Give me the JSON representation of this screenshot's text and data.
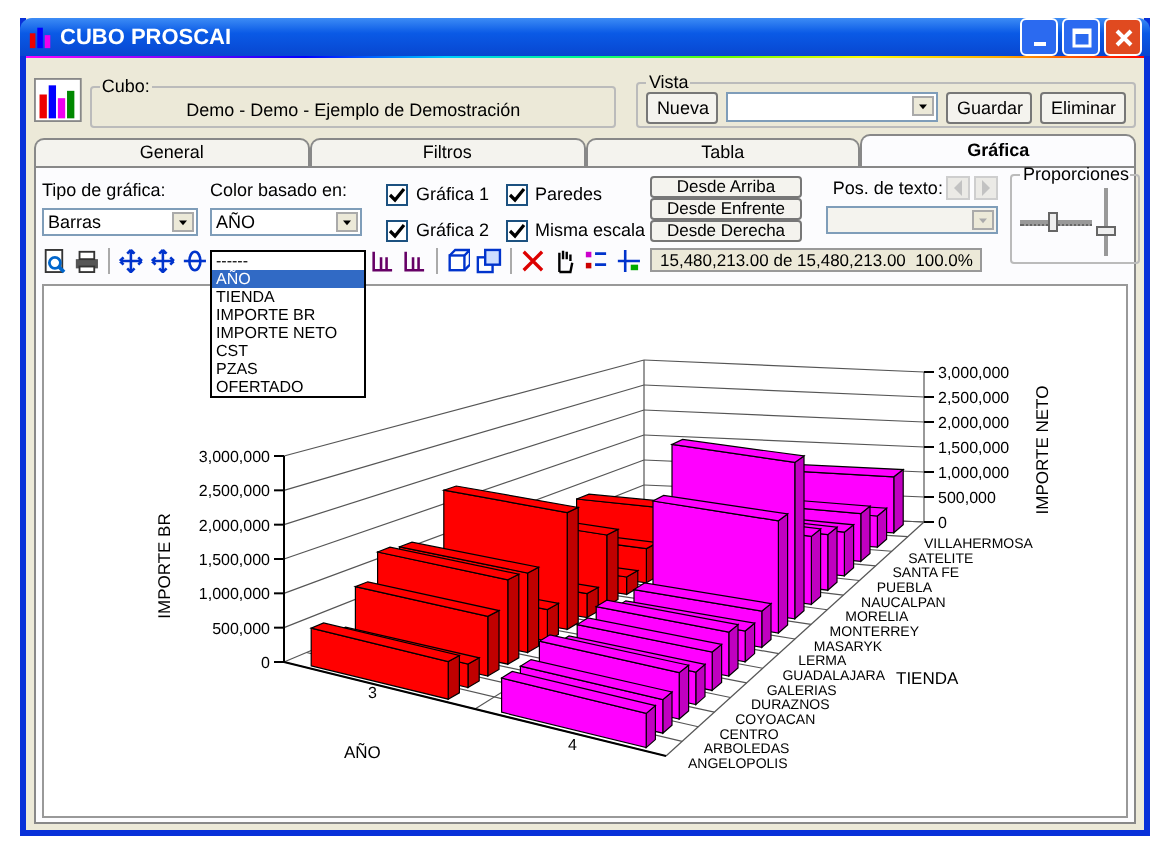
{
  "window": {
    "title": "CUBO PROSCAI"
  },
  "cube": {
    "label": "Cubo:",
    "value": "Demo - Demo - Ejemplo de Demostración"
  },
  "view": {
    "label": "Vista",
    "new_button": "Nueva",
    "save_button": "Guardar",
    "delete_button": "Eliminar"
  },
  "tabs": [
    {
      "label": "General",
      "selected": false
    },
    {
      "label": "Filtros",
      "selected": false
    },
    {
      "label": "Tabla",
      "selected": false
    },
    {
      "label": "Gráfica",
      "selected": true
    }
  ],
  "chart_type": {
    "label": "Tipo de gráfica:",
    "value": "Barras"
  },
  "color_by": {
    "label": "Color basado en:",
    "value": "AÑO",
    "options": [
      {
        "text": "------",
        "selected": false
      },
      {
        "text": "AÑO",
        "selected": true
      },
      {
        "text": "TIENDA",
        "selected": false
      },
      {
        "text": "IMPORTE BR",
        "selected": false
      },
      {
        "text": "IMPORTE NETO",
        "selected": false
      },
      {
        "text": "CST",
        "selected": false
      },
      {
        "text": "PZAS",
        "selected": false
      },
      {
        "text": "OFERTADO",
        "selected": false
      }
    ]
  },
  "checkboxes": [
    {
      "label": "Gráfica 1",
      "checked": true
    },
    {
      "label": "Paredes",
      "checked": true
    },
    {
      "label": "Gráfica 2",
      "checked": true
    },
    {
      "label": "Misma escala",
      "checked": true
    }
  ],
  "view_buttons": [
    "Desde Arriba",
    "Desde Enfrente",
    "Desde Derecha"
  ],
  "text_position": {
    "label": "Pos. de texto:",
    "disabled": true
  },
  "status": "15,480,213.00 de 15,480,213.00  100.0%",
  "proportions": {
    "label": "Proporciones",
    "sliders": [
      {
        "kind": "horizontal",
        "level": 0.42
      },
      {
        "kind": "vertical",
        "level": 0.34
      }
    ]
  },
  "chart": {
    "left_axis": {
      "title": "IMPORTE BR",
      "ticks": [
        "3,000,000",
        "2,500,000",
        "2,000,000",
        "1,500,000",
        "1,000,000",
        "500,000",
        "0"
      ]
    },
    "right_axis": {
      "title": "IMPORTE NETO",
      "ticks": [
        "3,000,000",
        "2,500,000",
        "2,000,000",
        "1,500,000",
        "1,000,000",
        "500,000",
        "0"
      ]
    },
    "year_axis": {
      "title": "AÑO",
      "labels": [
        "3",
        "4"
      ]
    },
    "store_axis": {
      "title": "TIENDA",
      "labels": [
        "VILLAHERMOSA",
        "SATELITE",
        "SANTA FE",
        "PUEBLA",
        "NAUCALPAN",
        "MORELIA",
        "MONTERREY",
        "MASARYK",
        "LERMA",
        "GUADALAJARA",
        "GALERIAS",
        "DURAZNOS",
        "COYOACAN",
        "CENTRO",
        "ARBOLEDAS",
        "ANGELOPOLIS"
      ]
    }
  }
}
